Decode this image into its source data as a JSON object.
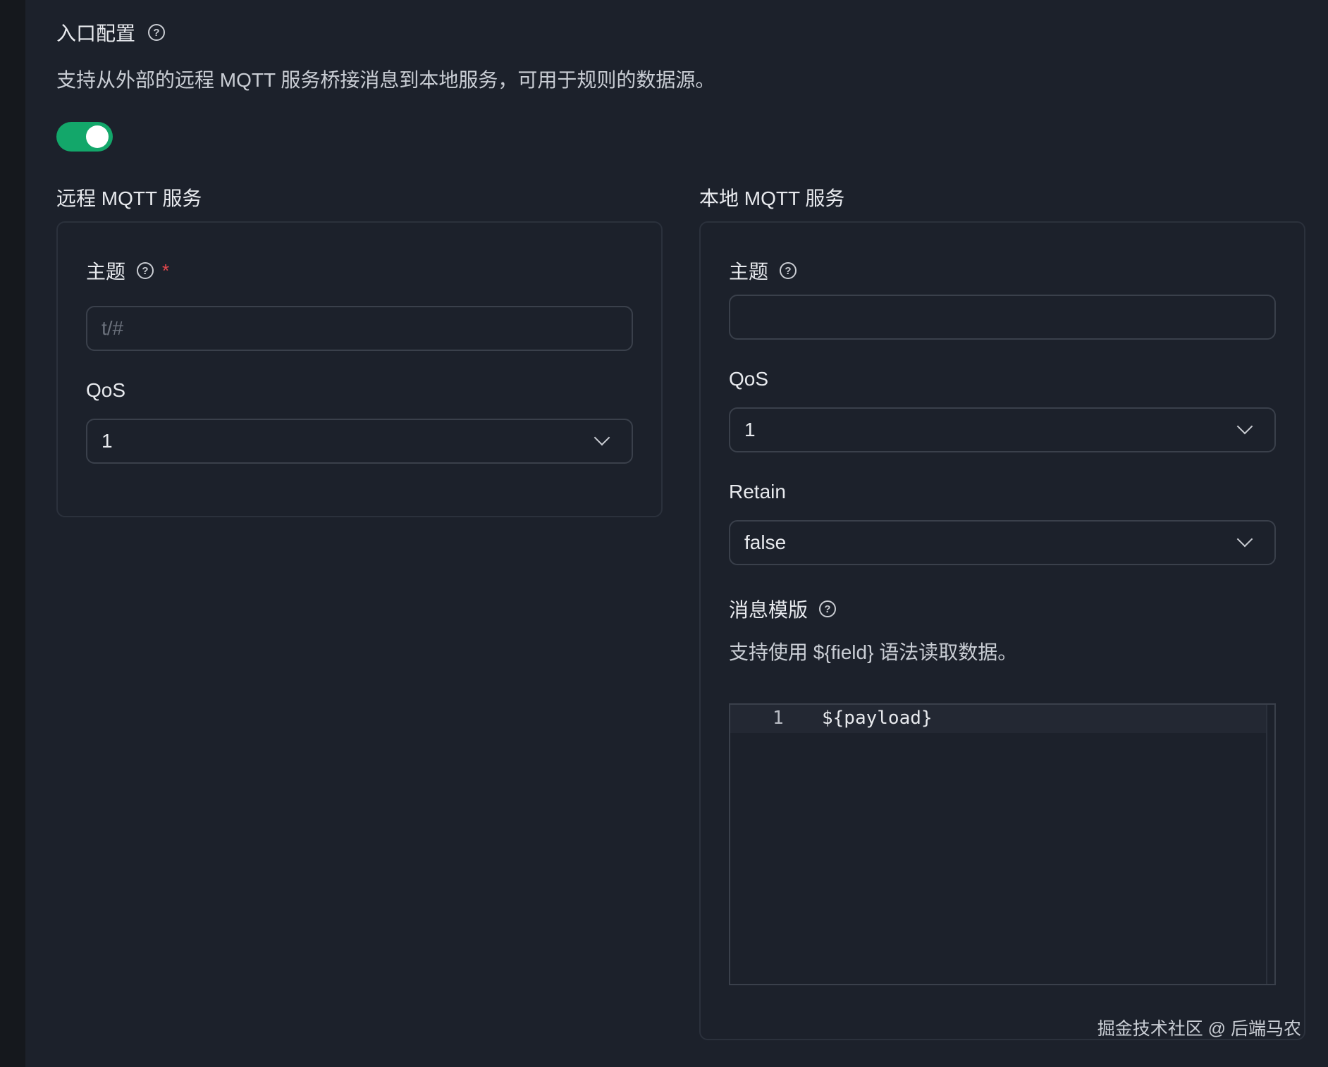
{
  "section": {
    "title": "入口配置",
    "description": "支持从外部的远程 MQTT 服务桥接消息到本地服务，可用于规则的数据源。",
    "enabled": true
  },
  "remote": {
    "title": "远程 MQTT 服务",
    "topic_label": "主题",
    "topic_required_mark": "*",
    "topic_placeholder": "t/#",
    "qos_label": "QoS",
    "qos_value": "1"
  },
  "local": {
    "title": "本地 MQTT 服务",
    "topic_label": "主题",
    "topic_value": "",
    "qos_label": "QoS",
    "qos_value": "1",
    "retain_label": "Retain",
    "retain_value": "false",
    "template_label": "消息模版",
    "template_help": "支持使用 ${field} 语法读取数据。",
    "template_line_number": "1",
    "template_code": "${payload}"
  },
  "icons": {
    "help": "help-circle-icon",
    "dropdown": "chevron-down-icon"
  },
  "colors": {
    "toggle_on": "#13a76a",
    "required": "#e5484d",
    "background": "#1c212b"
  },
  "watermark": "掘金技术社区 @ 后端马农"
}
